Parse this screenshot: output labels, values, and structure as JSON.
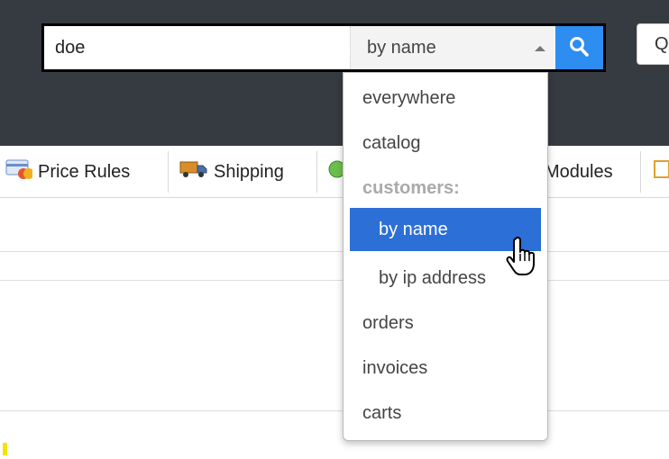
{
  "search": {
    "query": "doe",
    "scope_label": "by name",
    "submit_icon": "magnifier-icon"
  },
  "quick_access": {
    "label": "Q"
  },
  "nav": {
    "items": [
      {
        "label": "Price Rules",
        "icon": "price-rules-icon"
      },
      {
        "label": "Shipping",
        "icon": "truck-icon"
      },
      {
        "label": "",
        "icon": "globe-icon"
      },
      {
        "label": "Modules",
        "icon": "modules-icon"
      },
      {
        "label": "",
        "icon": "stats-icon"
      }
    ]
  },
  "dropdown": {
    "items": [
      {
        "label": "everywhere",
        "type": "option"
      },
      {
        "label": "catalog",
        "type": "option"
      },
      {
        "label": "customers:",
        "type": "group"
      },
      {
        "label": "by name",
        "type": "option",
        "indent": true,
        "selected": true
      },
      {
        "label": "by ip address",
        "type": "option",
        "indent": true
      },
      {
        "label": "orders",
        "type": "option"
      },
      {
        "label": "invoices",
        "type": "option"
      },
      {
        "label": "carts",
        "type": "option"
      }
    ]
  },
  "colors": {
    "header_bg": "#363a41",
    "accent": "#2d8df0",
    "selected_bg": "#2c6fd6"
  }
}
